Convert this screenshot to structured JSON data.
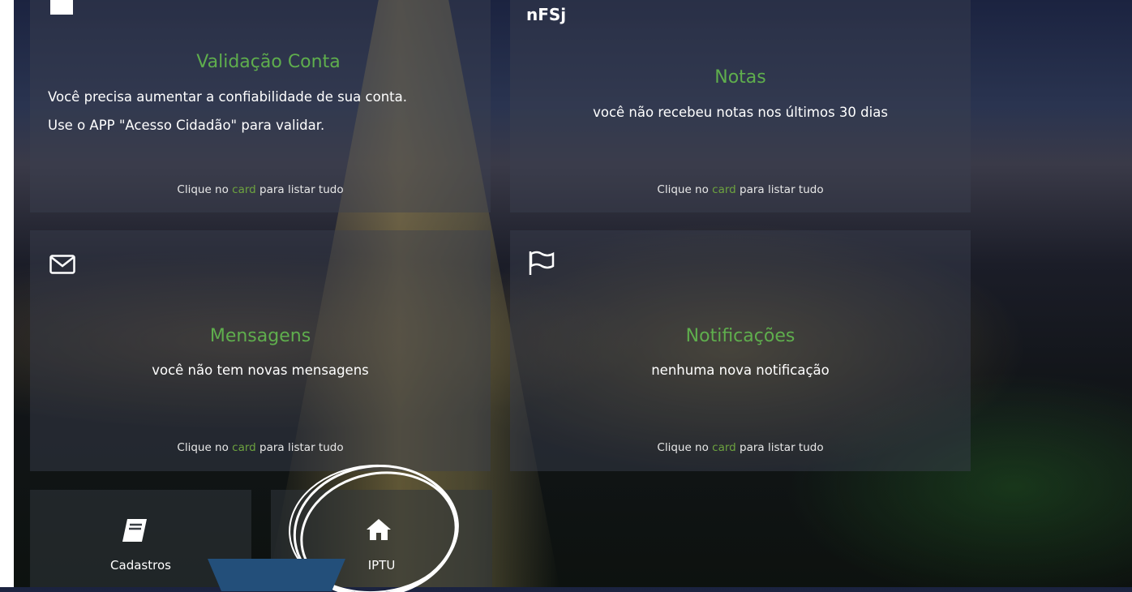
{
  "cards": {
    "validacao": {
      "title": "Validação Conta",
      "line1": "Você precisa aumentar a confiabilidade de sua conta.",
      "line2": "Use o APP \"Acesso Cidadão\" para validar.",
      "footer_pre": "Clique no ",
      "footer_hl": "card",
      "footer_post": " para listar tudo",
      "icon": "lock-icon"
    },
    "notas": {
      "logo_text": "nFSj",
      "title": "Notas",
      "text": "você não recebeu notas nos últimos 30 dias",
      "footer_pre": "Clique no ",
      "footer_hl": "card",
      "footer_post": " para listar tudo",
      "icon": "nfse-logo"
    },
    "mensagens": {
      "title": "Mensagens",
      "text": "você não tem novas mensagens",
      "footer_pre": "Clique no ",
      "footer_hl": "card",
      "footer_post": " para listar tudo",
      "icon": "envelope-icon"
    },
    "notificacoes": {
      "title": "Notificações",
      "text": "nenhuma nova notificação",
      "footer_pre": "Clique no ",
      "footer_hl": "card",
      "footer_post": " para listar tudo",
      "icon": "flag-icon"
    }
  },
  "shortcuts": [
    {
      "label": "Cadastros",
      "icon": "book-icon"
    },
    {
      "label": "IPTU",
      "icon": "home-icon"
    }
  ],
  "colors": {
    "accent_green": "#5fae4d",
    "arrow_blue": "#234f7a"
  }
}
